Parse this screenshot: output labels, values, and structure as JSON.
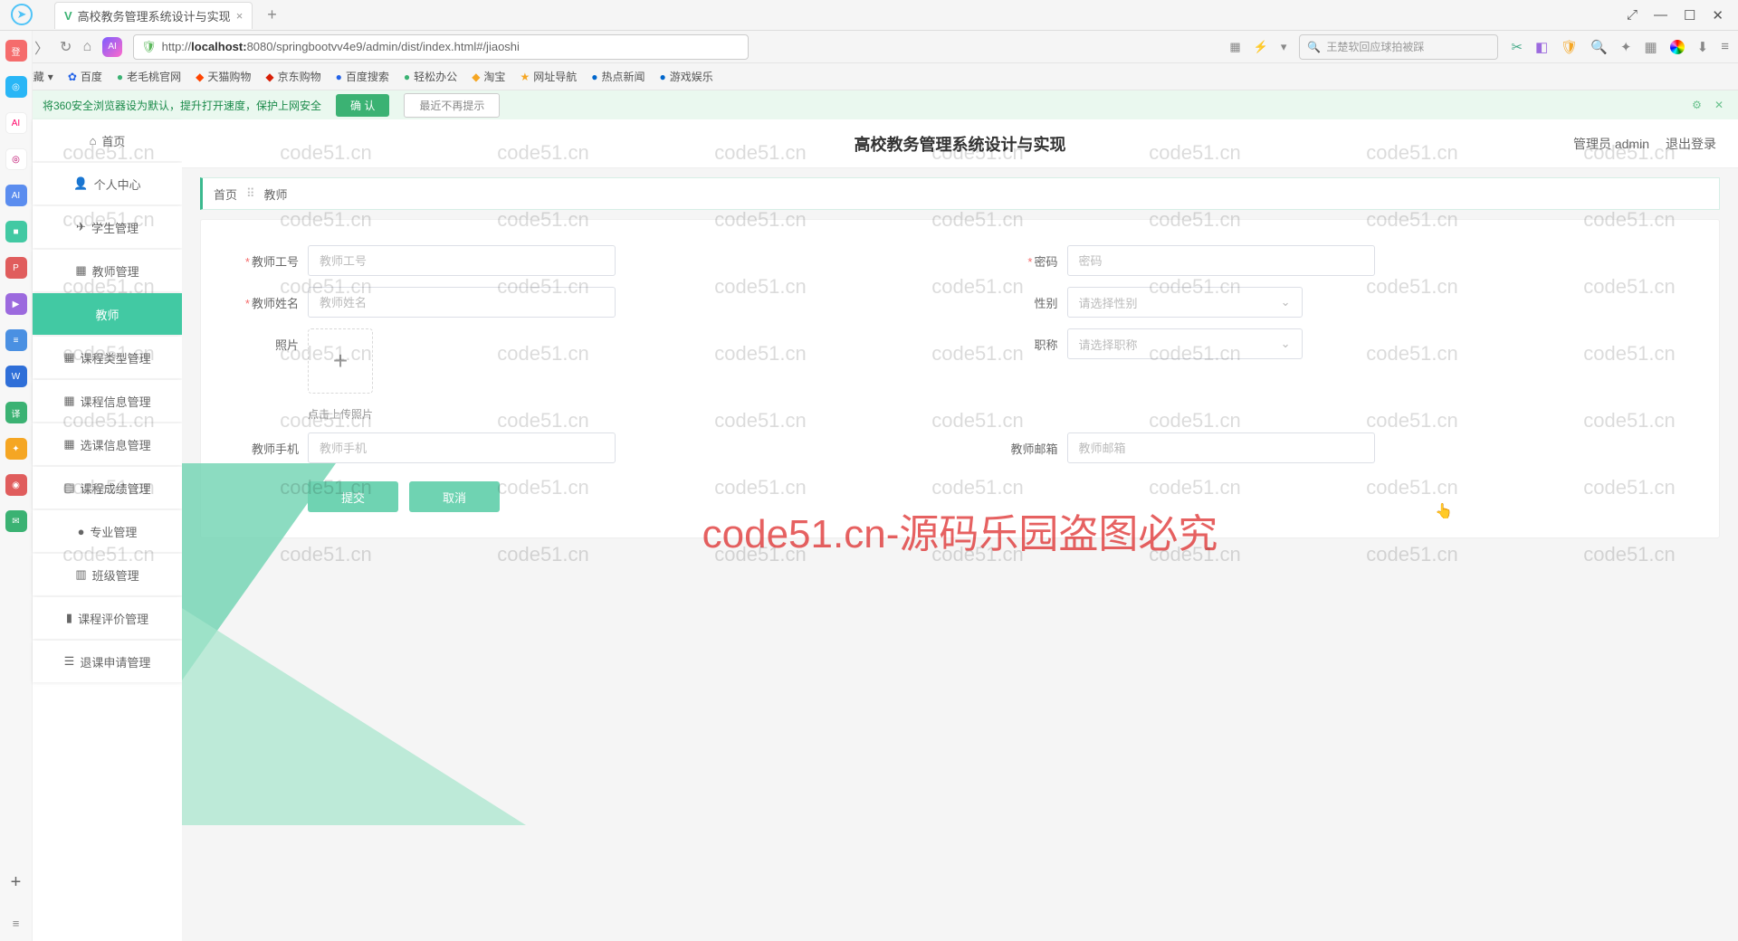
{
  "browser": {
    "tab_title": "高校教务管理系统设计与实现",
    "url_prefix": "http://",
    "url_host": "localhost:",
    "url_port": "8080",
    "url_path": "/springbootvv4e9/admin/dist/index.html#/jiaoshi",
    "search_placeholder": "王楚软回应球拍被踩",
    "notice_text": "将360安全浏览器设为默认，提升打开速度，保护上网安全",
    "notice_confirm": "确 认",
    "notice_noshow": "最近不再提示",
    "bookmarks": [
      "收藏",
      "百度",
      "老毛桃官网",
      "天猫购物",
      "京东购物",
      "百度搜索",
      "轻松办公",
      "淘宝",
      "网址导航",
      "热点新闻",
      "游戏娱乐"
    ]
  },
  "header": {
    "title": "高校教务管理系统设计与实现",
    "role": "管理员 admin",
    "logout": "退出登录"
  },
  "sidebar": {
    "items": [
      {
        "icon": "⌂",
        "label": "首页"
      },
      {
        "icon": "👤",
        "label": "个人中心"
      },
      {
        "icon": "✈",
        "label": "学生管理"
      },
      {
        "icon": "▦",
        "label": "教师管理"
      },
      {
        "icon": "",
        "label": "教师"
      },
      {
        "icon": "▦",
        "label": "课程类型管理"
      },
      {
        "icon": "▦",
        "label": "课程信息管理"
      },
      {
        "icon": "▦",
        "label": "选课信息管理"
      },
      {
        "icon": "▤",
        "label": "课程成绩管理"
      },
      {
        "icon": "●",
        "label": "专业管理"
      },
      {
        "icon": "▥",
        "label": "班级管理"
      },
      {
        "icon": "▮",
        "label": "课程评价管理"
      },
      {
        "icon": "☰",
        "label": "退课申请管理"
      }
    ]
  },
  "breadcrumb": {
    "home": "首页",
    "current": "教师"
  },
  "form": {
    "teacher_id_label": "教师工号",
    "teacher_id_ph": "教师工号",
    "password_label": "密码",
    "password_ph": "密码",
    "teacher_name_label": "教师姓名",
    "teacher_name_ph": "教师姓名",
    "gender_label": "性别",
    "gender_ph": "请选择性别",
    "photo_label": "照片",
    "upload_hint": "点击上传照片",
    "title_label": "职称",
    "title_ph": "请选择职称",
    "phone_label": "教师手机",
    "phone_ph": "教师手机",
    "email_label": "教师邮箱",
    "email_ph": "教师邮箱",
    "submit": "提交",
    "cancel": "取消"
  },
  "watermark": {
    "small": "code51.cn",
    "big": "code51.cn-源码乐园盗图必究"
  }
}
